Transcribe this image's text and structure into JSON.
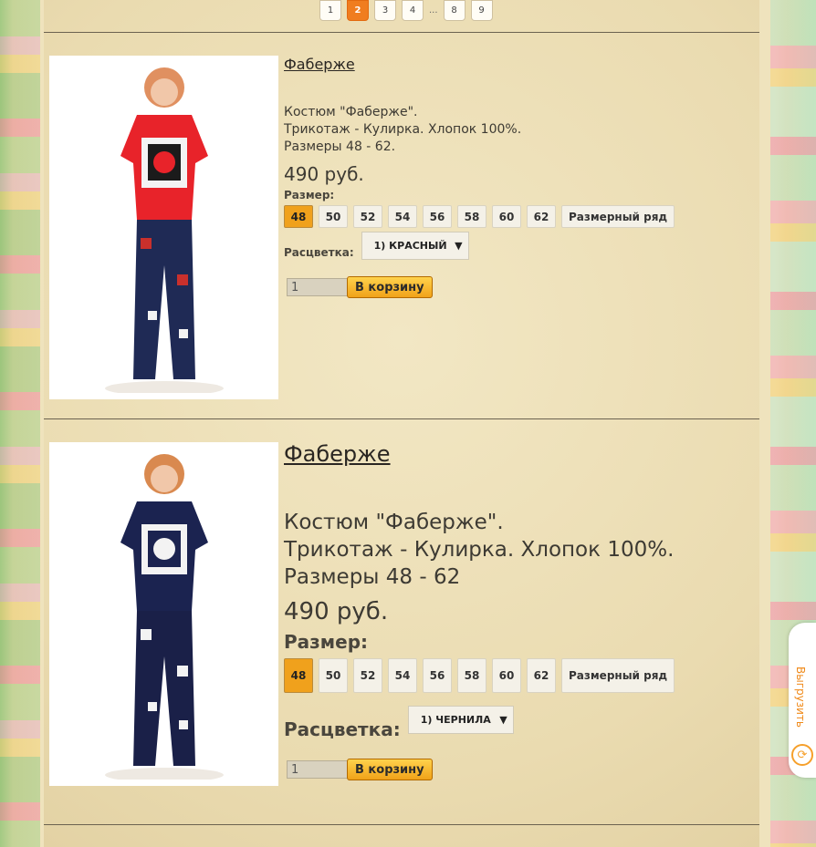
{
  "pagination": {
    "pages": [
      "1",
      "2",
      "3",
      "4",
      "8",
      "9"
    ],
    "active": "2",
    "ellipsis": "..."
  },
  "products": [
    {
      "title": "Фаберже",
      "desc": [
        "Костюм \"Фаберже\".",
        "Трикотаж - Кулирка. Хлопок 100%.",
        "Размеры 48 - 62."
      ],
      "price": "490 руб.",
      "size_label": "Размер:",
      "sizes": [
        "48",
        "50",
        "52",
        "54",
        "56",
        "58",
        "60",
        "62"
      ],
      "size_chart": "Размерный ряд",
      "selected_size": "48",
      "color_label": "Расцветка:",
      "color_value": "1) КРАСНЫЙ",
      "qty": "1",
      "cart_button": "В корзину",
      "image_colors": {
        "top": "#e8232a",
        "print": "#f3f3f3",
        "pants": "#1f2a55"
      }
    },
    {
      "title": "Фаберже",
      "desc": [
        "Костюм \"Фаберже\".",
        "Трикотаж - Кулирка. Хлопок 100%.",
        "Размеры 48 - 62"
      ],
      "price": "490 руб.",
      "size_label": "Размер:",
      "sizes": [
        "48",
        "50",
        "52",
        "54",
        "56",
        "58",
        "60",
        "62"
      ],
      "size_chart": "Размерный ряд",
      "selected_size": "48",
      "color_label": "Расцветка:",
      "color_value": "1) ЧЕРНИЛА",
      "qty": "1",
      "cart_button": "В корзину",
      "image_colors": {
        "top": "#1b2350",
        "print": "#f3f3f3",
        "pants": "#1a2048"
      }
    }
  ],
  "side_tab": {
    "label": "Выгрузить",
    "icon": "sync-icon"
  },
  "colors": {
    "accent": "#f07d1f",
    "button": "#f0a219"
  }
}
